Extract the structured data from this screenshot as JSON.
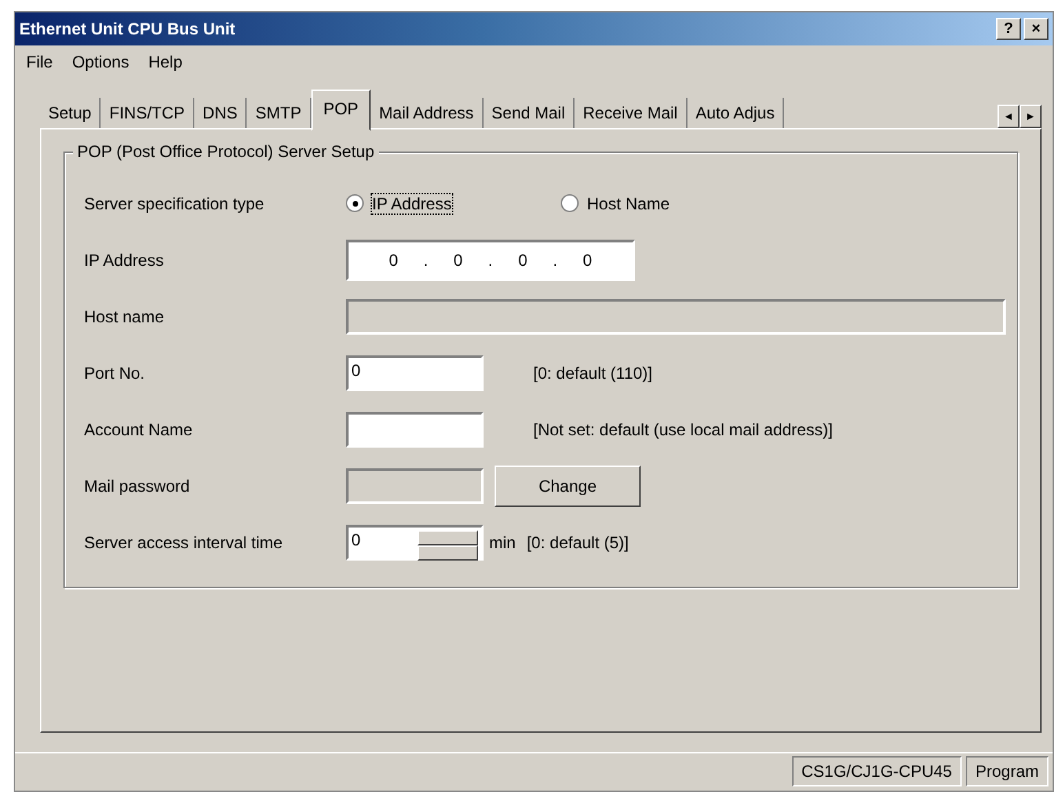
{
  "window": {
    "title": "Ethernet Unit CPU Bus Unit",
    "help_button": "?",
    "close_button": "×"
  },
  "menu": [
    "File",
    "Options",
    "Help"
  ],
  "tabs": [
    {
      "label": "Setup",
      "selected": false
    },
    {
      "label": "FINS/TCP",
      "selected": false
    },
    {
      "label": "DNS",
      "selected": false
    },
    {
      "label": "SMTP",
      "selected": false
    },
    {
      "label": "POP",
      "selected": true
    },
    {
      "label": "Mail Address",
      "selected": false
    },
    {
      "label": "Send Mail",
      "selected": false
    },
    {
      "label": "Receive Mail",
      "selected": false
    },
    {
      "label": "Auto Adjus",
      "selected": false
    }
  ],
  "tab_scroll": [
    "◄",
    "►"
  ],
  "group": {
    "title": "POP (Post Office Protocol) Server Setup",
    "rows": [
      {
        "kind": "radio",
        "label": "Server specification type",
        "options": [
          {
            "label": "IP Address",
            "selected": true,
            "focused": true
          },
          {
            "label": "Host Name",
            "selected": false,
            "focused": false
          }
        ]
      },
      {
        "kind": "ip",
        "label": "IP Address",
        "octets": [
          "0",
          "0",
          "0",
          "0"
        ],
        "separator": "."
      },
      {
        "kind": "text",
        "label": "Host name",
        "disabled": true
      },
      {
        "kind": "text",
        "label": "Port No.",
        "value": "0",
        "disabled": false,
        "note": "[0: default (110)]"
      },
      {
        "kind": "text",
        "label": "Account Name",
        "disabled": false,
        "note": "[Not set: default (use local mail address)]"
      },
      {
        "kind": "password",
        "label": "Mail password",
        "disabled": true,
        "button": "Change"
      },
      {
        "kind": "spin",
        "label": "Server access interval time",
        "value": "0",
        "unit": "min",
        "note": "[0: default (5)]"
      }
    ]
  },
  "status_bar": {
    "model": "CS1G/CJ1G-CPU45",
    "mode": "Program"
  }
}
